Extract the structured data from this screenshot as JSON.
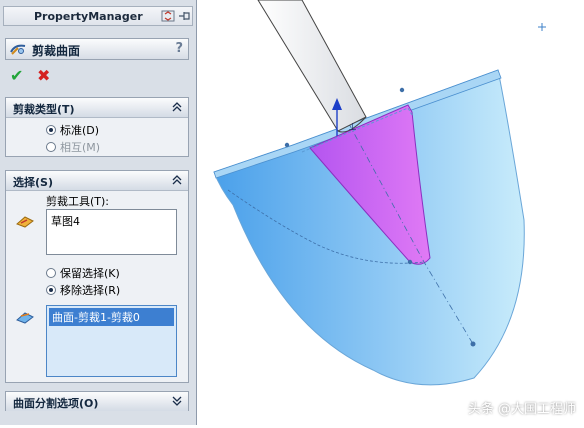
{
  "panel": {
    "title": "PropertyManager",
    "feature_title": "剪裁曲面",
    "help": "?",
    "ok_glyph": "✔",
    "cancel_glyph": "✖"
  },
  "trim_type": {
    "header": "剪裁类型(T)",
    "options": [
      {
        "label": "标准(D)",
        "selected": true,
        "enabled": true
      },
      {
        "label": "相互(M)",
        "selected": false,
        "enabled": false
      }
    ]
  },
  "selection": {
    "header": "选择(S)",
    "trim_tool_label": "剪裁工具(T):",
    "trim_tool_value": "草图4",
    "keep_label": "保留选择(K)",
    "remove_label": "移除选择(R)",
    "remove_selected": true,
    "selected_items": [
      "曲面-剪裁1-剪裁0"
    ]
  },
  "split_options": {
    "header": "曲面分割选项(O)"
  },
  "watermark": "头条 @大国工程师",
  "colors": {
    "surface_blue": "#8ec8f4",
    "highlight_magenta": "#b455f0",
    "panel_bg": "#d9dfe7"
  }
}
